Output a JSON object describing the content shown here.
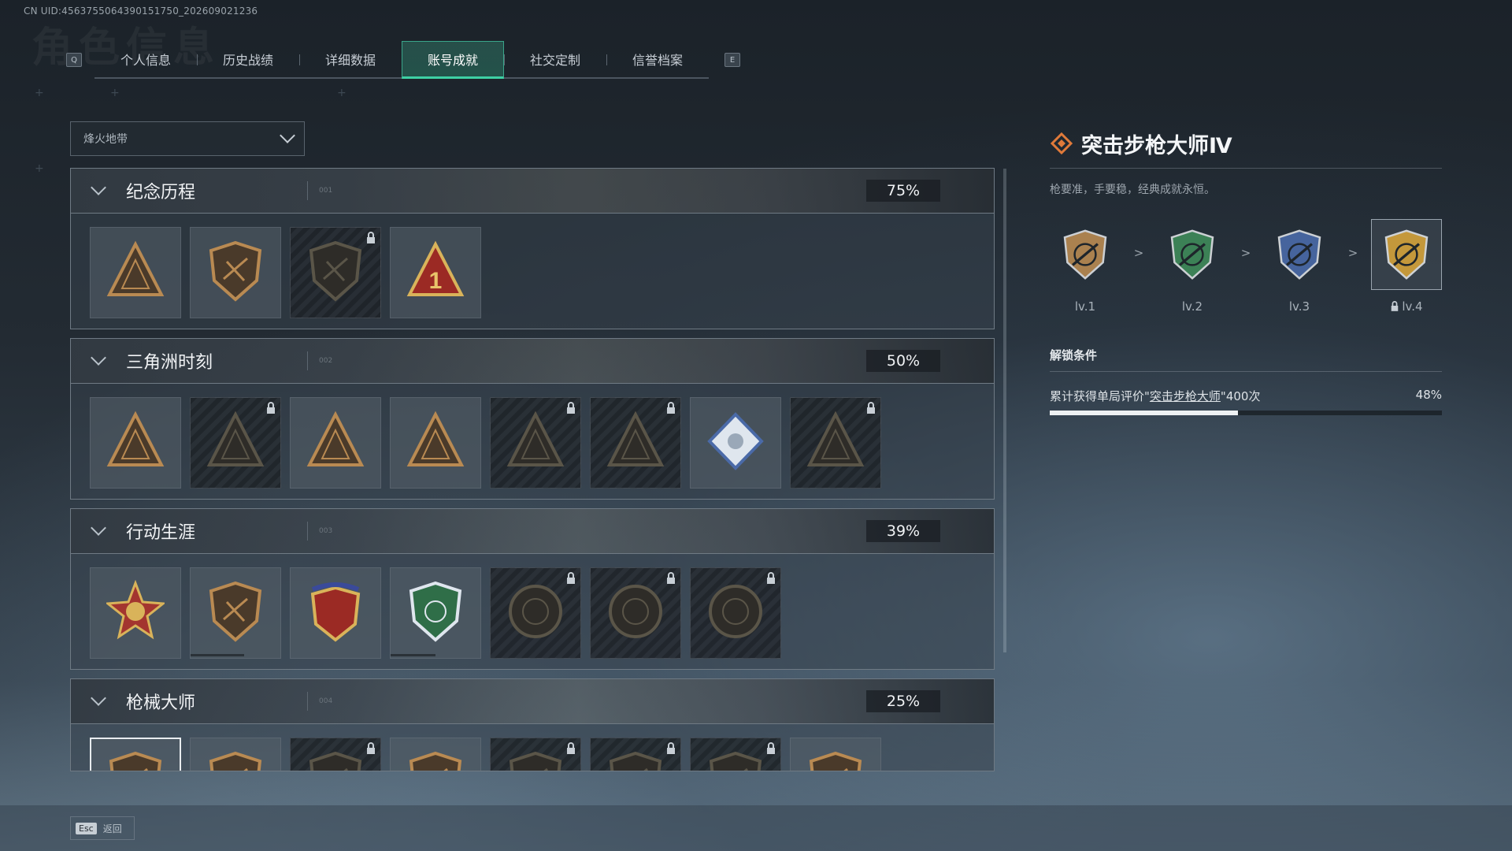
{
  "uid_text": "CN UID:4563755064390151750_202609021236",
  "ghost_title": "角色信息",
  "tabs": {
    "left_key": "Q",
    "right_key": "E",
    "items": [
      {
        "label": "个人信息"
      },
      {
        "label": "历史战绩"
      },
      {
        "label": "详细数据"
      },
      {
        "label": "账号成就",
        "active": true
      },
      {
        "label": "社交定制"
      },
      {
        "label": "信誉档案"
      }
    ]
  },
  "mode_select": {
    "value": "烽火地带"
  },
  "sections": [
    {
      "title": "纪念历程",
      "num": "001",
      "percent": "75%",
      "progress": 0.75,
      "badges": [
        {
          "icon": "triangle-shield-badge-icon",
          "locked": false
        },
        {
          "icon": "helicopter-badge-icon",
          "locked": false
        },
        {
          "icon": "tech-shield-badge-icon",
          "locked": true
        },
        {
          "icon": "number-one-badge-icon",
          "locked": false
        }
      ]
    },
    {
      "title": "三角洲时刻",
      "num": "002",
      "percent": "50%",
      "progress": 0.5,
      "badges": [
        {
          "icon": "supply-triangle-badge-icon",
          "locked": false
        },
        {
          "icon": "soldier-triangle-badge-icon",
          "locked": true
        },
        {
          "icon": "dice-triangle-badge-icon",
          "locked": false
        },
        {
          "icon": "squad-triangle-badge-icon",
          "locked": false
        },
        {
          "icon": "team-triangle-badge-icon",
          "locked": true
        },
        {
          "icon": "fish-triangle-badge-icon",
          "locked": true
        },
        {
          "icon": "rose-diamond-badge-icon",
          "locked": false
        },
        {
          "icon": "dragon-triangle-badge-icon",
          "locked": true
        }
      ]
    },
    {
      "title": "行动生涯",
      "num": "003",
      "percent": "39%",
      "progress": 0.39,
      "badges": [
        {
          "icon": "star-medal-badge-icon",
          "locked": false
        },
        {
          "icon": "bronze-shield-badge-icon",
          "locked": false,
          "bar": 0.6
        },
        {
          "icon": "eagle-crest-badge-icon",
          "locked": false
        },
        {
          "icon": "green-shield-badge-icon",
          "locked": false,
          "bar": 0.5
        },
        {
          "icon": "round-helmet-badge-icon",
          "locked": true
        },
        {
          "icon": "round-skull-badge-icon",
          "locked": true
        },
        {
          "icon": "round-eye-badge-icon",
          "locked": true
        }
      ]
    },
    {
      "title": "枪械大师",
      "num": "004",
      "percent": "25%",
      "progress": 0.25,
      "badges": [
        {
          "icon": "rifle-master-badge-icon",
          "locked": false,
          "selected": true
        },
        {
          "icon": "smg-master-badge-icon",
          "locked": false
        },
        {
          "icon": "shotgun-master-badge-icon",
          "locked": true
        },
        {
          "icon": "lmg-master-badge-icon",
          "locked": false
        },
        {
          "icon": "marksman-master-badge-icon",
          "locked": true
        },
        {
          "icon": "sniper-master-badge-icon",
          "locked": true
        },
        {
          "icon": "pistol-master-badge-icon",
          "locked": true
        },
        {
          "icon": "launcher-master-badge-icon",
          "locked": false
        }
      ]
    }
  ],
  "detail": {
    "title": "突击步枪大师Ⅳ",
    "description": "枪要准，手要稳，经典成就永恒。",
    "levels": [
      {
        "label": "lv.1",
        "tier": "bronze",
        "locked": false
      },
      {
        "label": "lv.2",
        "tier": "green",
        "locked": false
      },
      {
        "label": "lv.3",
        "tier": "blue",
        "locked": false
      },
      {
        "label": "lv.4",
        "tier": "gold",
        "locked": true,
        "selected": true
      }
    ],
    "arrow": ">",
    "unlock_heading": "解锁条件",
    "condition_prefix": "累计获得单局评价\"",
    "condition_link": "突击步枪大师",
    "condition_suffix": "\"400次",
    "condition_percent": "48%",
    "condition_progress": 0.48
  },
  "footer": {
    "esc_key": "Esc",
    "back_label": "返回"
  },
  "colors": {
    "accent": "#3ed0a4",
    "title_diamond": "#e07a3a",
    "bronze": "#b98a52",
    "green": "#3f8a5a",
    "blue": "#4a6aa8",
    "gold": "#d4a23a"
  }
}
